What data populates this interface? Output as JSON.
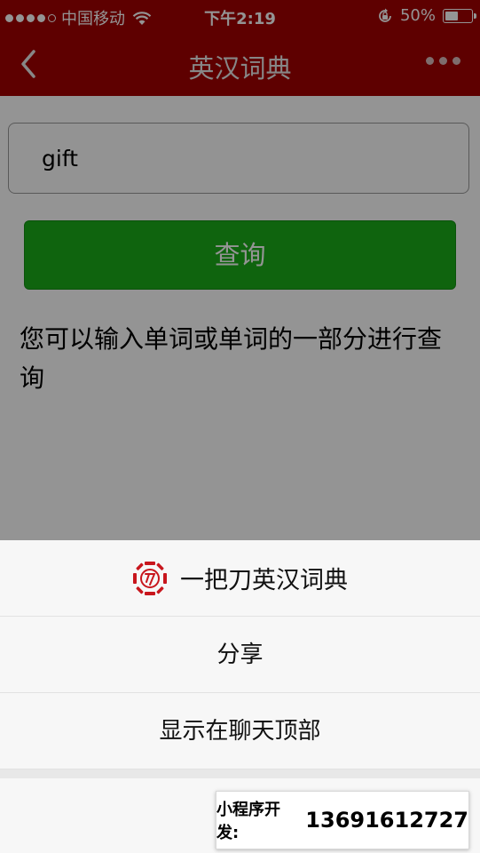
{
  "status_bar": {
    "carrier": "中国移动",
    "time": "下午2:19",
    "battery": "50%",
    "battery_level": 0.5
  },
  "navbar": {
    "title": "英汉词典"
  },
  "search": {
    "value": "gift"
  },
  "query_button": {
    "label": "查询"
  },
  "hint_text": "您可以输入单词或单词的一部分进行查询",
  "action_sheet": {
    "app_name": "一把刀英汉词典",
    "items": [
      "分享",
      "显示在聊天顶部"
    ]
  },
  "developer_banner": {
    "label": "小程序开发:",
    "phone": "13691612727"
  },
  "colors": {
    "nav_red": "#a30000",
    "button_green": "#1aad19"
  }
}
